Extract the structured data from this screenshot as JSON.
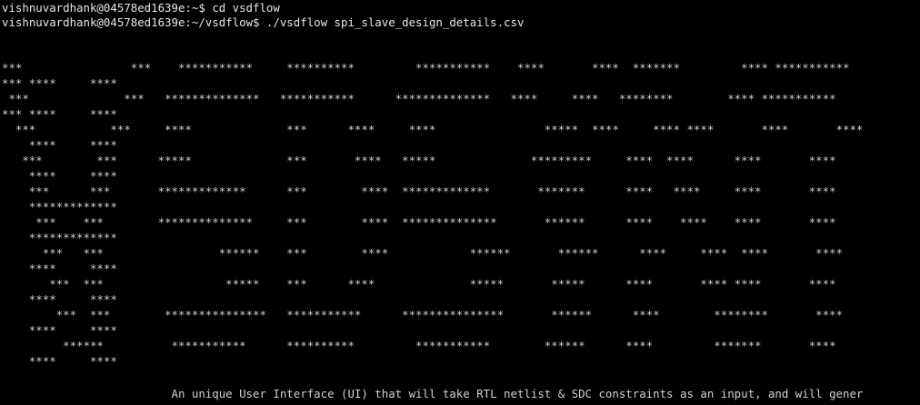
{
  "terminal": {
    "commands": [
      "vishnuvardhank@04578ed1639e:~$ cd vsdflow",
      "vishnuvardhank@04578ed1639e:~/vsdflow$ ./vsdflow spi_slave_design_details.csv"
    ],
    "banner_lines": [
      "***                ***    ***********     **********         ***********    ****       ****  *******         **** ***********",
      "*** ****     ****",
      " ***              ***   **************   ***********      **************   ****     ****   ********        **** ***********",
      "*** ****     ****",
      "  ***           ***     ****              ***      ****     ****                *****  ****     **** ****       ****       ****",
      "    ****     ****",
      "   ***        ***      *****              ***       ****   *****              *********     ****  ****      ****       ****",
      "    ****     ****",
      "    ***      ***       *************      ***        ****  *************       *******      ****   ****     ****       ****",
      "    *************",
      "     ***    ***        **************     ***        ****  **************       ******      ****    ****    ****       ****",
      "    *************",
      "      ***   ***                 ******    ***        ****            ******       ******      ****     ****  ****       ****",
      "    ****     ****",
      "       ***  ***                  *****    ***      ****              *****       *****      ****       **** ****       ****",
      "    ****     ****",
      "        ***  ***        ***************   ***********      ***************       ******      ****        ********       ****",
      "    ****     ****",
      "         ******          ***********      **********         ***********        ******      ****         *******       ****",
      "    ****     ****"
    ],
    "tagline": "                         An unique User Interface (UI) that will take RTL netlist & SDC constraints as an input, and will gener"
  }
}
